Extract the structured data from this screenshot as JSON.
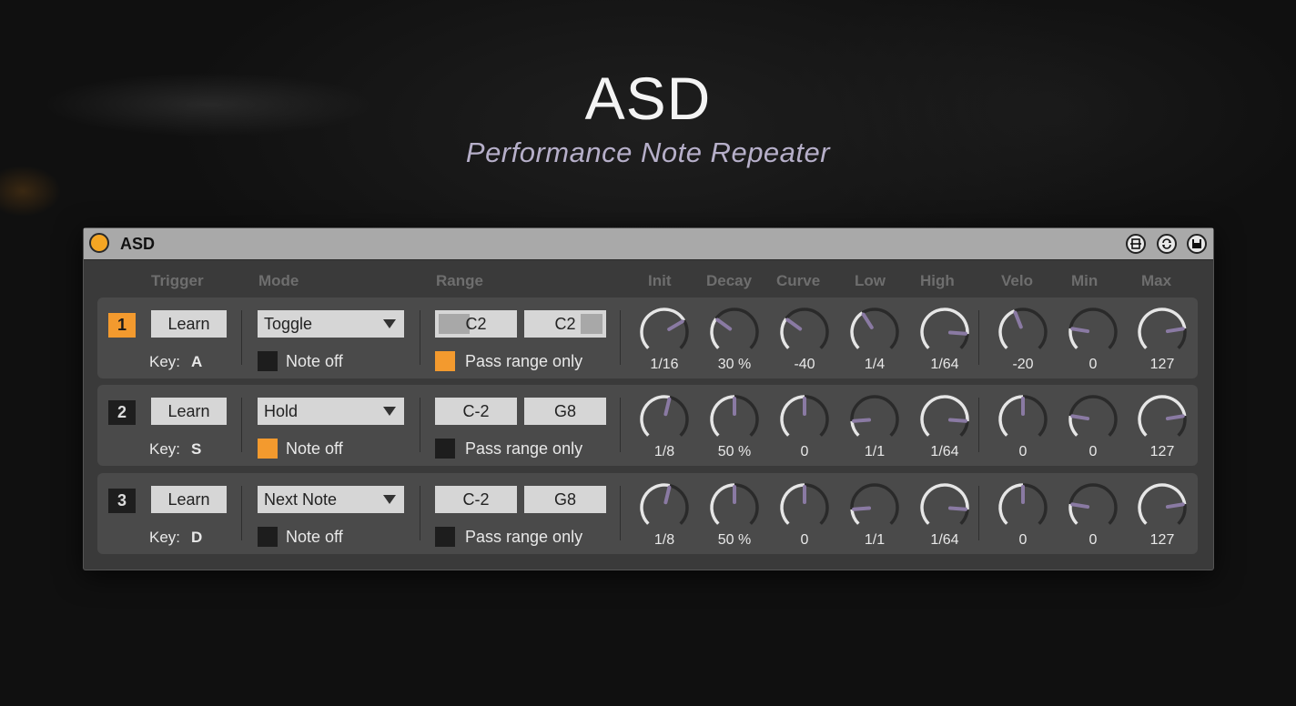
{
  "header": {
    "title": "ASD",
    "subtitle": "Performance Note Repeater"
  },
  "device": {
    "name": "ASD",
    "accent_color": "#f39a2e",
    "knob_pointer_color": "#8a7aa3"
  },
  "columns": {
    "trigger": "Trigger",
    "mode": "Mode",
    "range": "Range",
    "init": "Init",
    "decay": "Decay",
    "curve": "Curve",
    "low": "Low",
    "high": "High",
    "velo": "Velo",
    "min": "Min",
    "max": "Max"
  },
  "rows": [
    {
      "index": "1",
      "active": true,
      "learn": "Learn",
      "key_label": "Key:",
      "key": "A",
      "mode": "Toggle",
      "note_off_label": "Note off",
      "note_off": false,
      "range_low": "C2",
      "range_high": "C2",
      "pass_label": "Pass range only",
      "pass_range": true,
      "knobs": [
        {
          "label": "1/16",
          "level": 0.72
        },
        {
          "label": "30 %",
          "level": 0.3
        },
        {
          "label": "-40",
          "level": 0.3
        },
        {
          "label": "1/4",
          "level": 0.38
        },
        {
          "label": "1/64",
          "level": 0.85
        },
        {
          "label": "-20",
          "level": 0.42
        },
        {
          "label": "0",
          "level": 0.2
        },
        {
          "label": "127",
          "level": 0.8
        }
      ]
    },
    {
      "index": "2",
      "active": false,
      "learn": "Learn",
      "key_label": "Key:",
      "key": "S",
      "mode": "Hold",
      "note_off_label": "Note off",
      "note_off": true,
      "range_low": "C-2",
      "range_high": "G8",
      "pass_label": "Pass range only",
      "pass_range": false,
      "knobs": [
        {
          "label": "1/8",
          "level": 0.55
        },
        {
          "label": "50 %",
          "level": 0.5
        },
        {
          "label": "0",
          "level": 0.5
        },
        {
          "label": "1/1",
          "level": 0.15
        },
        {
          "label": "1/64",
          "level": 0.85
        },
        {
          "label": "0",
          "level": 0.5
        },
        {
          "label": "0",
          "level": 0.2
        },
        {
          "label": "127",
          "level": 0.8
        }
      ]
    },
    {
      "index": "3",
      "active": false,
      "learn": "Learn",
      "key_label": "Key:",
      "key": "D",
      "mode": "Next Note",
      "note_off_label": "Note off",
      "note_off": false,
      "range_low": "C-2",
      "range_high": "G8",
      "pass_label": "Pass range only",
      "pass_range": false,
      "knobs": [
        {
          "label": "1/8",
          "level": 0.55
        },
        {
          "label": "50 %",
          "level": 0.5
        },
        {
          "label": "0",
          "level": 0.5
        },
        {
          "label": "1/1",
          "level": 0.15
        },
        {
          "label": "1/64",
          "level": 0.85
        },
        {
          "label": "0",
          "level": 0.5
        },
        {
          "label": "0",
          "level": 0.2
        },
        {
          "label": "127",
          "level": 0.8
        }
      ]
    }
  ]
}
